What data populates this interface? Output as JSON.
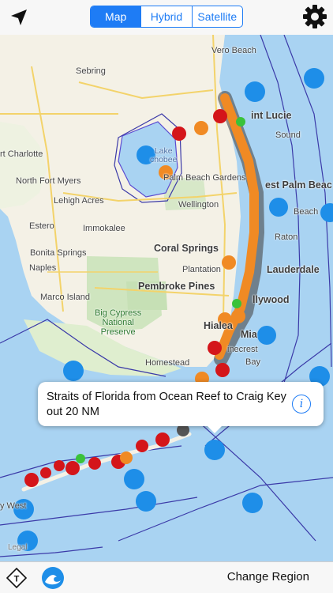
{
  "toolbar": {
    "segments": [
      {
        "label": "Map",
        "active": true
      },
      {
        "label": "Hybrid",
        "active": false
      },
      {
        "label": "Satellite",
        "active": false
      }
    ],
    "accent_color": "#1e7cf5",
    "locate_icon": "location-arrow-icon",
    "settings_icon": "gear-icon"
  },
  "map": {
    "places": {
      "vero_beach": "Vero Beach",
      "sebring": "Sebring",
      "port_st_lucie": "int Lucie",
      "port_charlotte": "rt Charlotte",
      "lake_okeechobee": "Lake\nchobee",
      "palm_beach_gardens": "Palm Beach Gardens",
      "north_fort_myers": "North Fort Myers",
      "west_palm_beach": "est Palm Beac",
      "lehigh_acres": "Lehigh Acres",
      "wellington": "Wellington",
      "estero": "Estero",
      "immokalee": "Immokalee",
      "boca_raton": "Raton",
      "coral_springs": "Coral Springs",
      "bonita_springs": "Bonita Springs",
      "plantation": "Plantation",
      "fort_lauderdale": "Lauderdale",
      "naples": "Naples",
      "pembroke_pines": "Pembroke Pines",
      "hollywood": "llywood",
      "marco_island": "Marco Island",
      "big_cypress": "Big Cypress\nNational\nPreserve",
      "hialeah": "Hialea",
      "miami": "Mia",
      "pinecrest": "inecrest",
      "homestead": "Homestead",
      "bay": "Bay",
      "sound": "Sound",
      "beach": "Beach",
      "key_west": "y West",
      "legal": "Legal"
    }
  },
  "callout": {
    "text": "Straits of Florida from Ocean Reef to Craig Key out 20 NM",
    "info_icon": "info-icon",
    "info_label": "i"
  },
  "bottombar": {
    "tide_icon": "tide-station-icon",
    "tide_label": "T",
    "wave_icon": "wave-icon",
    "change_region_label": "Change Region"
  }
}
